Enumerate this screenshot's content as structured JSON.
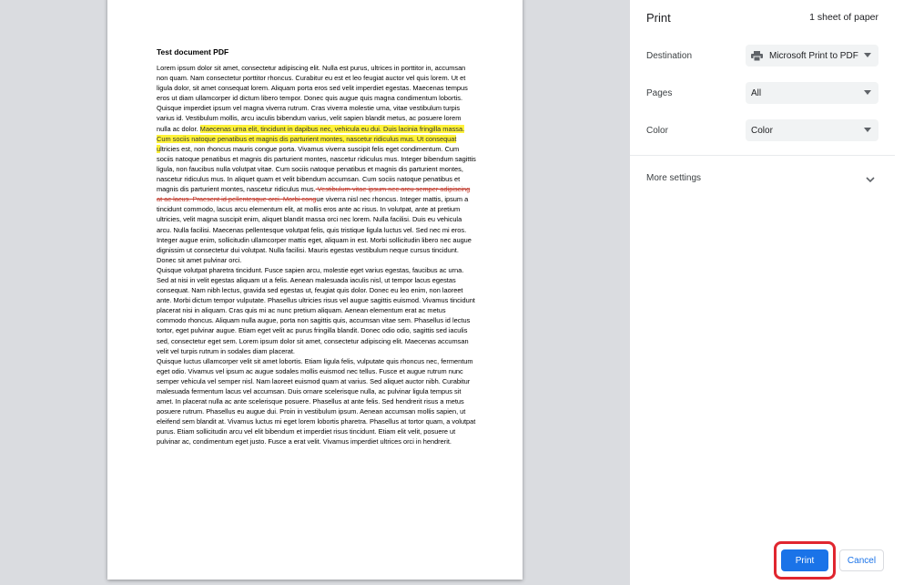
{
  "preview": {
    "doc_title": "Test document PDF",
    "body_intro": "Lorem ipsum dolor sit amet, consectetur adipiscing elit. Nulla est purus, ultrices in porttitor in, accumsan non quam. Nam consectetur porttitor rhoncus. Curabitur eu est et leo feugiat auctor vel quis lorem. Ut et ligula dolor, sit amet consequat lorem. Aliquam porta eros sed velit imperdiet egestas. Maecenas tempus eros ut diam ullamcorper id dictum libero tempor. Donec quis augue quis magna condimentum lobortis. Quisque imperdiet ipsum vel magna viverra rutrum. Cras viverra molestie urna, vitae vestibulum turpis varius id. Vestibulum mollis, arcu iaculis bibendum varius, velit sapien blandit metus, ac posuere lorem nulla ac dolor. ",
    "body_highlight": "Maecenas urna elit, tincidunt in dapibus nec, vehicula eu dui. Duis lacinia fringilla massa. Cum sociis natoque penatibus et magnis dis parturient montes, nascetur ridiculus mus. Ut consequat u",
    "body_mid": "ltricies est, non rhoncus mauris congue porta. Vivamus viverra suscipit felis eget condimentum. Cum sociis natoque penatibus et magnis dis parturient montes, nascetur ridiculus mus. Integer bibendum sagittis ligula, non faucibus nulla volutpat vitae. Cum sociis natoque penatibus et magnis dis parturient montes, nascetur ridiculus mus. In aliquet quam et velit bibendum accumsan. Cum sociis natoque penatibus et magnis dis parturient montes, nascetur ridiculus mus.",
    "body_strike": " Vestibulum vitae ipsum nec arcu semper adipiscing at ac lacus. Praesent id pellentesque orci. Morbi cong",
    "body_rest": "ue viverra nisl nec rhoncus. Integer mattis, ipsum a tincidunt commodo, lacus arcu elementum elit, at mollis eros ante ac risus. In volutpat, ante at pretium ultricies, velit magna suscipit enim, aliquet blandit massa orci nec lorem. Nulla facilisi. Duis eu vehicula arcu. Nulla facilisi. Maecenas pellentesque volutpat felis, quis tristique ligula luctus vel. Sed nec mi eros. Integer augue enim, sollicitudin ullamcorper mattis eget, aliquam in est. Morbi sollicitudin libero nec augue dignissim ut consectetur dui volutpat. Nulla facilisi. Mauris egestas vestibulum neque cursus tincidunt. Donec sit amet pulvinar orci.",
    "para2": "Quisque volutpat pharetra tincidunt. Fusce sapien arcu, molestie eget varius egestas, faucibus ac urna. Sed at nisi in velit egestas aliquam ut a felis. Aenean malesuada iaculis nisl, ut tempor lacus egestas consequat. Nam nibh lectus, gravida sed egestas ut, feugiat quis dolor. Donec eu leo enim, non laoreet ante. Morbi dictum tempor vulputate. Phasellus ultricies risus vel augue sagittis euismod. Vivamus tincidunt placerat nisi in aliquam. Cras quis mi ac nunc pretium aliquam. Aenean elementum erat ac metus commodo rhoncus. Aliquam nulla augue, porta non sagittis quis, accumsan vitae sem. Phasellus id lectus tortor, eget pulvinar augue. Etiam eget velit ac purus fringilla blandit. Donec odio odio, sagittis sed iaculis sed, consectetur eget sem. Lorem ipsum dolor sit amet, consectetur adipiscing elit. Maecenas accumsan velit vel turpis rutrum in sodales diam placerat.",
    "para3": "Quisque luctus ullamcorper velit sit amet lobortis. Etiam ligula felis, vulputate quis rhoncus nec, fermentum eget odio. Vivamus vel ipsum ac augue sodales mollis euismod nec tellus. Fusce et augue rutrum nunc semper vehicula vel semper nisl. Nam laoreet euismod quam at varius. Sed aliquet auctor nibh. Curabitur malesuada fermentum lacus vel accumsan. Duis ornare scelerisque nulla, ac pulvinar ligula tempus sit amet. In placerat nulla ac ante scelerisque posuere. Phasellus at ante felis. Sed hendrerit risus a metus posuere rutrum. Phasellus eu augue dui. Proin in vestibulum ipsum. Aenean accumsan mollis sapien, ut eleifend sem blandit at. Vivamus luctus mi eget lorem lobortis pharetra. Phasellus at tortor quam, a volutpat purus. Etiam sollicitudin arcu vel elit bibendum et imperdiet risus tincidunt. Etiam elit velit, posuere ut pulvinar ac, condimentum eget justo. Fusce a erat velit. Vivamus imperdiet ultrices orci in hendrerit."
  },
  "settings": {
    "title": "Print",
    "sheet_count": "1 sheet of paper",
    "destination": {
      "label": "Destination",
      "value": "Microsoft Print to PDF",
      "icon": "printer-icon"
    },
    "pages": {
      "label": "Pages",
      "value": "All"
    },
    "color": {
      "label": "Color",
      "value": "Color"
    },
    "more_settings": "More settings",
    "print_label": "Print",
    "cancel_label": "Cancel"
  },
  "colors": {
    "accent": "#1a73e8",
    "highlight": "#fff23a",
    "annotation_ring": "#e0262f",
    "strike": "#c0392b"
  }
}
